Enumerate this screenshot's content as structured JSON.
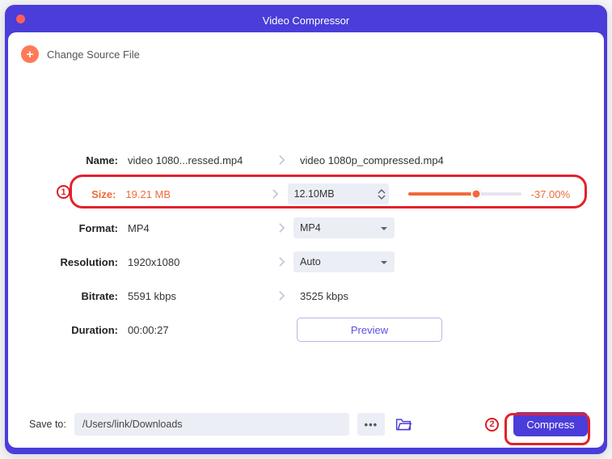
{
  "window": {
    "title": "Video Compressor"
  },
  "header": {
    "change_source_label": "Change Source File"
  },
  "rows": {
    "name": {
      "label": "Name:",
      "source": "video 1080...ressed.mp4",
      "target": "video 1080p_compressed.mp4"
    },
    "size": {
      "label": "Size:",
      "source": "19.21 MB",
      "target": "12.10MB",
      "percent": "-37.00%"
    },
    "format": {
      "label": "Format:",
      "source": "MP4",
      "target": "MP4"
    },
    "resolution": {
      "label": "Resolution:",
      "source": "1920x1080",
      "target": "Auto"
    },
    "bitrate": {
      "label": "Bitrate:",
      "source": "5591 kbps",
      "target": "3525 kbps"
    },
    "duration": {
      "label": "Duration:",
      "source": "00:00:27"
    }
  },
  "preview": {
    "label": "Preview"
  },
  "footer": {
    "save_to_label": "Save to:",
    "path": "/Users/link/Downloads",
    "compress_label": "Compress"
  },
  "annotations": {
    "badge1": "1",
    "badge2": "2"
  },
  "colors": {
    "accent": "#4a3dd9",
    "warn": "#ef6a3a",
    "highlight": "#e2222a"
  }
}
